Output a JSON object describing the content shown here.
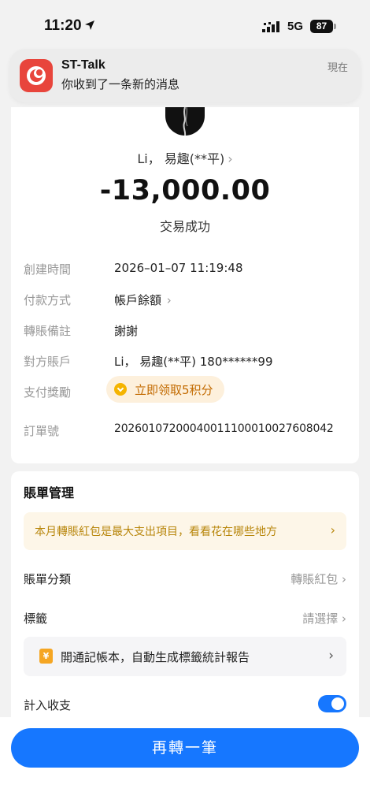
{
  "status_bar": {
    "time": "11:20",
    "network": "5G",
    "battery": "87"
  },
  "notification": {
    "app_name": "ST-Talk",
    "message": "你收到了一条新的消息",
    "time": "現在"
  },
  "transaction": {
    "payee": "Li， 易趣(**平)",
    "amount": "-13,000.00",
    "status": "交易成功",
    "details": [
      {
        "label": "創建時間",
        "value": "2026–01–07 11:19:48"
      },
      {
        "label": "付款方式",
        "value": "帳戶餘額"
      },
      {
        "label": "轉賬備註",
        "value": "謝謝"
      },
      {
        "label": "對方賬戶",
        "value": "Li， 易趣(**平) 180******99"
      },
      {
        "label": "支付獎勵",
        "value": "立即领取5积分"
      },
      {
        "label": "訂單號",
        "value": "20260107200040011100010027608042"
      }
    ]
  },
  "bill_management": {
    "title": "賬單管理",
    "tip": "本月轉賬紅包是最大支出項目，看看花在哪些地方",
    "category_label": "賬單分類",
    "category_value": "轉賬紅包",
    "tag_label": "標籤",
    "tag_value": "請選擇",
    "ledger_promo": "開通記帳本，自動生成標籤統計報告",
    "ledger_icon": "¥",
    "count_label": "計入收支",
    "count_enabled": true
  },
  "action": {
    "primary_label": "再轉一筆"
  },
  "colors": {
    "accent": "#1677ff",
    "reward": "#c26a00",
    "notif_icon": "#e8453c"
  }
}
